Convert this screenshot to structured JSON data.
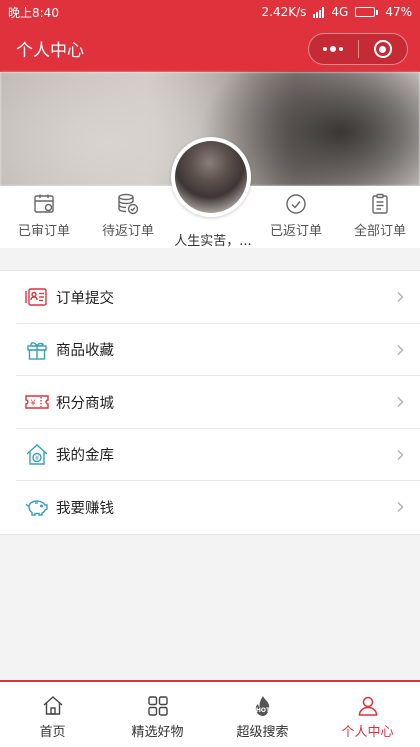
{
  "status_bar": {
    "time": "晚上8:40",
    "network_speed": "2.42K/s",
    "network_type": "4G",
    "battery": "47%",
    "battery_level": 0.47
  },
  "nav": {
    "title": "个人中心"
  },
  "profile": {
    "username": "人生实苦，..."
  },
  "orders": [
    {
      "label": "已审订单",
      "icon": "calendar-icon"
    },
    {
      "label": "待返订单",
      "icon": "coin-stack-icon"
    },
    {
      "label": "已返订单",
      "icon": "check-circle-icon"
    },
    {
      "label": "全部订单",
      "icon": "clipboard-icon"
    }
  ],
  "menu": [
    {
      "label": "订单提交",
      "icon": "id-card-icon"
    },
    {
      "label": "商品收藏",
      "icon": "gift-icon"
    },
    {
      "label": "积分商城",
      "icon": "coupon-icon"
    },
    {
      "label": "我的金库",
      "icon": "vault-house-icon"
    },
    {
      "label": "我要赚钱",
      "icon": "piggy-bank-icon"
    }
  ],
  "tabs": [
    {
      "label": "首页",
      "icon": "home-icon"
    },
    {
      "label": "精选好物",
      "icon": "grid-icon"
    },
    {
      "label": "超级搜索",
      "icon": "hot-icon"
    },
    {
      "label": "个人中心",
      "icon": "user-icon",
      "active": true
    }
  ],
  "colors": {
    "brand": "#e0323c",
    "menu_red": "#e0323c",
    "menu_teal": "#3aa0b8"
  }
}
